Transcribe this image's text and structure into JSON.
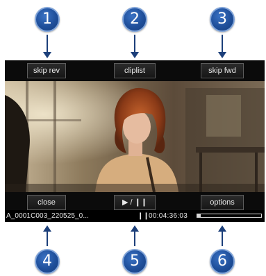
{
  "top_buttons": {
    "skip_rev": "skip rev",
    "cliplist": "cliplist",
    "skip_fwd": "skip fwd"
  },
  "bottom_buttons": {
    "close": "close",
    "play_pause": "▶ / ❙❙",
    "options": "options"
  },
  "status": {
    "clip_name": "A_0001C003_220525_0...",
    "pause_symbol": "❙❙",
    "timecode": "00:04:36:03",
    "progress": 0.05
  },
  "callouts": {
    "one": "1",
    "two": "2",
    "three": "3",
    "four": "4",
    "five": "5",
    "six": "6"
  },
  "colors": {
    "callout_fill": "#2a5fae",
    "arrow": "#1c3f7a",
    "player_bg": "#0b0b0b"
  }
}
